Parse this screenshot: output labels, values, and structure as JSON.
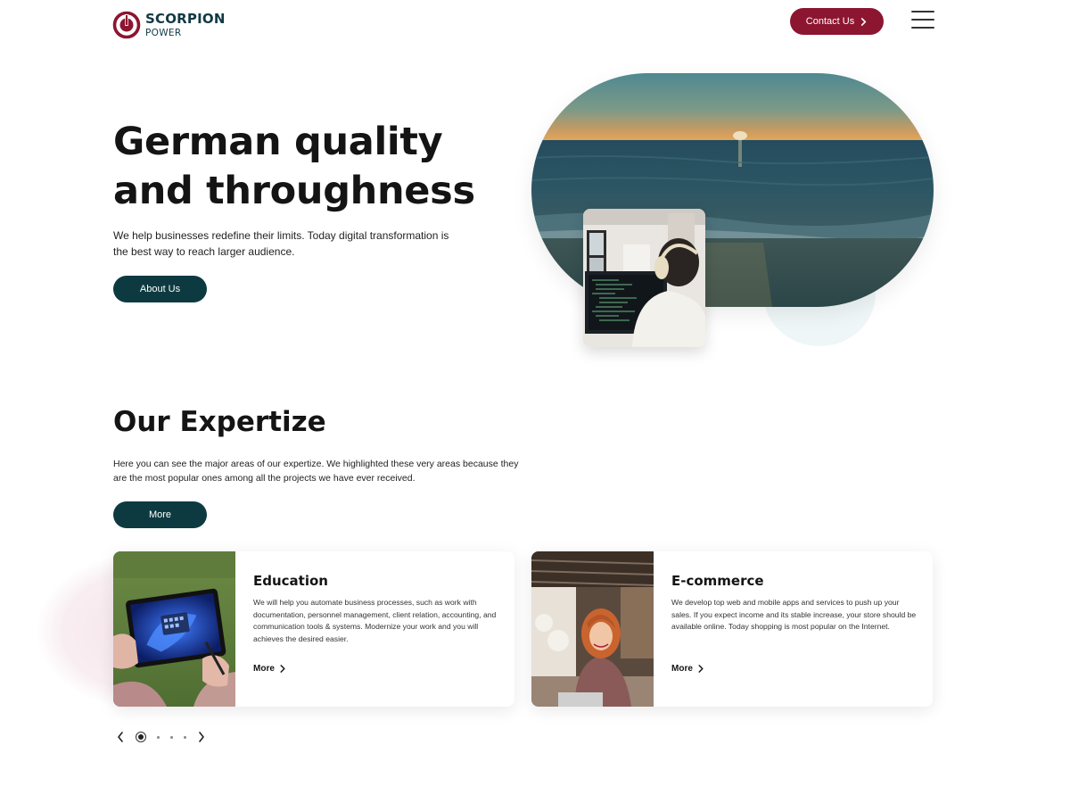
{
  "header": {
    "logo_name": "SCORPION",
    "logo_sub": "POWER",
    "contact_label": "Contact Us",
    "brand_color": "#8c1530",
    "accent_dark": "#0d3a40"
  },
  "hero": {
    "title": "German quality and throughness",
    "text": "We help businesses redefine their limits. Today digital transformation is the best way to reach larger audience.",
    "button_label": "About Us"
  },
  "expertise": {
    "title": "Our Expertize",
    "text": "Here you can see the major areas of our expertize. We highlighted these very areas because they are the most popular ones among all the projects we have ever received.",
    "button_label": "More",
    "cards": [
      {
        "title": "Education",
        "text": "We will help you automate business processes, such as work with documentation, personnel management, client relation, accounting, and communication tools & systems. Modernize your work and you will achieves the desired easier.",
        "more_label": "More"
      },
      {
        "title": "E-commerce",
        "text": "We develop top web and mobile apps and services to push up your sales. If you expect income and its stable increase, your store should be available online. Today shopping is most popular on the Internet.",
        "more_label": "More"
      }
    ]
  },
  "carousel": {
    "active_index": 1,
    "total": 4
  },
  "icons": {
    "logo": "power-logo-icon",
    "menu": "hamburger-icon",
    "chevron": "chevron-right-icon",
    "prev": "chevron-left-icon",
    "next": "chevron-right-icon"
  }
}
